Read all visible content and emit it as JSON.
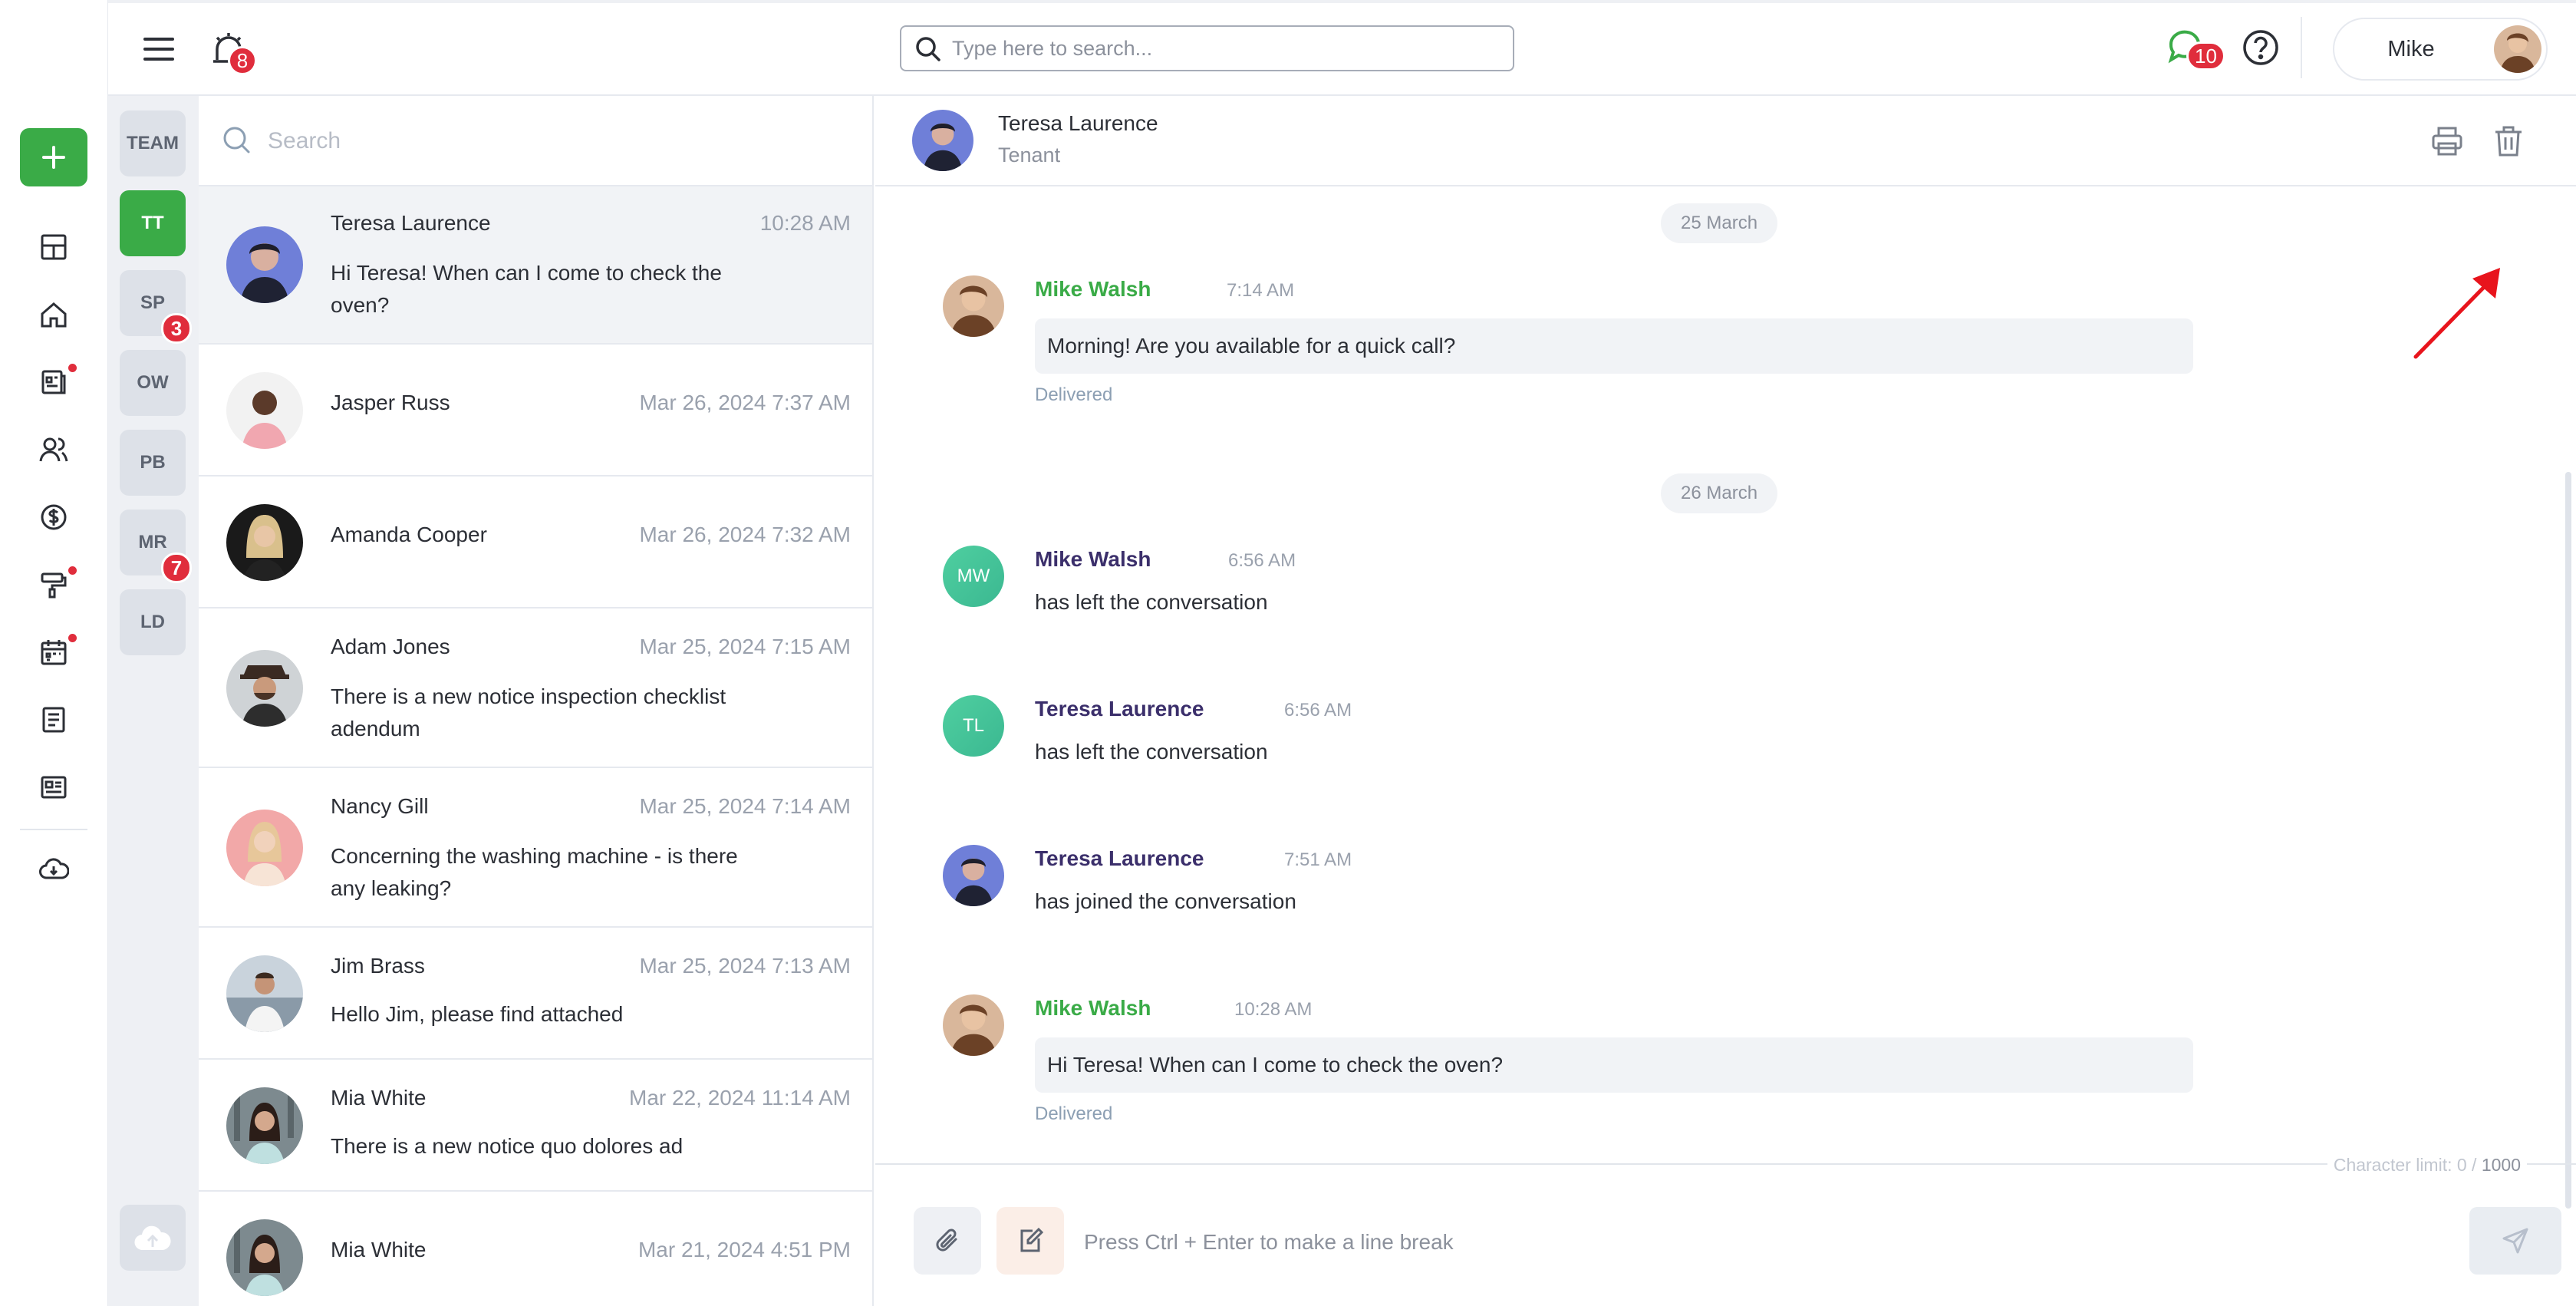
{
  "topbar": {
    "alarm_badge": "8",
    "search_placeholder": "Type here to search...",
    "chat_badge": "10",
    "user_name": "Mike"
  },
  "groups": [
    {
      "label": "TEAM",
      "badge": ""
    },
    {
      "label": "TT",
      "badge": ""
    },
    {
      "label": "SP",
      "badge": "3"
    },
    {
      "label": "OW",
      "badge": ""
    },
    {
      "label": "PB",
      "badge": ""
    },
    {
      "label": "MR",
      "badge": "7"
    },
    {
      "label": "LD",
      "badge": ""
    }
  ],
  "conversations": {
    "search_placeholder": "Search",
    "items": [
      {
        "name": "Teresa Laurence",
        "time": "10:28 AM",
        "preview": "Hi Teresa! When can I come to check the oven?"
      },
      {
        "name": "Jasper Russ",
        "time": "Mar 26, 2024 7:37 AM",
        "preview": ""
      },
      {
        "name": "Amanda Cooper",
        "time": "Mar 26, 2024 7:32 AM",
        "preview": ""
      },
      {
        "name": "Adam Jones",
        "time": "Mar 25, 2024 7:15 AM",
        "preview": "There is a new notice inspection checklist adendum"
      },
      {
        "name": "Nancy Gill",
        "time": "Mar 25, 2024 7:14 AM",
        "preview": "Concerning the washing machine - is there any leaking?"
      },
      {
        "name": "Jim Brass",
        "time": "Mar 25, 2024 7:13 AM",
        "preview": "Hello Jim, please find attached"
      },
      {
        "name": "Mia White",
        "time": "Mar 22, 2024 11:14 AM",
        "preview": "There is a new notice quo dolores ad"
      },
      {
        "name": "Mia White",
        "time": "Mar 21, 2024 4:51 PM",
        "preview": ""
      }
    ]
  },
  "chat": {
    "contact_name": "Teresa Laurence",
    "contact_role": "Tenant",
    "dates": [
      "25 March",
      "26 March"
    ],
    "messages": [
      {
        "author": "Mike Walsh",
        "time": "7:14 AM",
        "text": "Morning! Are you available for a quick call?",
        "status": "Delivered"
      },
      {
        "author": "Mike Walsh",
        "initials": "MW",
        "time": "6:56 AM",
        "text": "has left the conversation"
      },
      {
        "author": "Teresa Laurence",
        "initials": "TL",
        "time": "6:56 AM",
        "text": "has left the conversation"
      },
      {
        "author": "Teresa Laurence",
        "time": "7:51 AM",
        "text": "has joined the conversation"
      },
      {
        "author": "Mike Walsh",
        "time": "10:28 AM",
        "text": "Hi Teresa! When can I come to check the oven?",
        "status": "Delivered"
      }
    ],
    "char_limit_label": "Character limit: 0 /",
    "char_limit_max": "1000",
    "composer_placeholder": "Press Ctrl + Enter to make a line break"
  },
  "colors": {
    "accent_green": "#3aab47",
    "badge_red": "#e02d3c",
    "author_purple": "#3b2f6b",
    "annotation_arrow": "#e8141c"
  },
  "icons": [
    "plus-icon",
    "dashboard-icon",
    "home-icon",
    "documents-icon",
    "people-icon",
    "dollar-icon",
    "maintenance-icon",
    "calendar-icon",
    "notes-icon",
    "newspaper-icon",
    "download-icon",
    "menu-icon",
    "alarm-icon",
    "search-icon",
    "chat-icon",
    "help-icon",
    "print-icon",
    "trash-icon",
    "paperclip-icon",
    "template-icon",
    "send-icon",
    "upload-cloud-icon"
  ]
}
